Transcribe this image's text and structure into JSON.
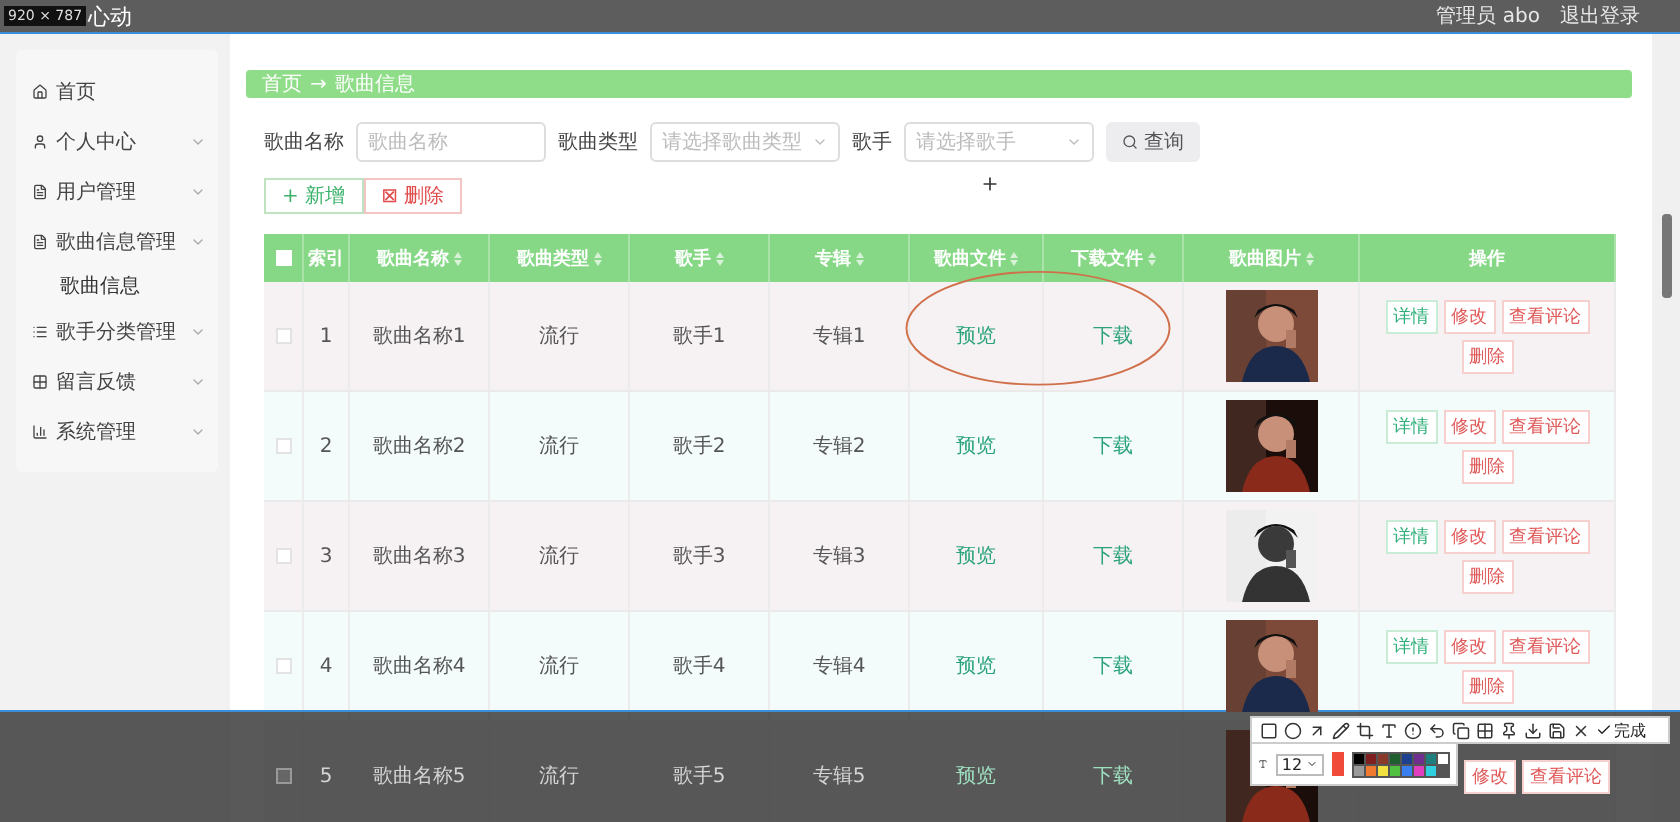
{
  "header": {
    "size_label": "920 × 787",
    "title": "心动",
    "user": "管理员 abo",
    "logout": "退出登录"
  },
  "sidebar": {
    "items": [
      {
        "label": "首页",
        "expandable": false
      },
      {
        "label": "个人中心",
        "expandable": true
      },
      {
        "label": "用户管理",
        "expandable": true
      },
      {
        "label": "歌曲信息管理",
        "expandable": true,
        "children": [
          {
            "label": "歌曲信息"
          }
        ]
      },
      {
        "label": "歌手分类管理",
        "expandable": true
      },
      {
        "label": "留言反馈",
        "expandable": true
      },
      {
        "label": "系统管理",
        "expandable": true
      }
    ]
  },
  "breadcrumb": [
    "首页",
    "→",
    "歌曲信息"
  ],
  "search": {
    "fields": [
      {
        "label": "歌曲名称",
        "placeholder": "歌曲名称",
        "kind": "input"
      },
      {
        "label": "歌曲类型",
        "placeholder": "请选择歌曲类型",
        "kind": "select"
      },
      {
        "label": "歌手",
        "placeholder": "请选择歌手",
        "kind": "select"
      }
    ],
    "button": "查询"
  },
  "actions": [
    {
      "label": "新增",
      "symbol": "+",
      "kind": "add"
    },
    {
      "label": "删除",
      "symbol": "⊠",
      "kind": "delete"
    }
  ],
  "table": {
    "header_checked": false,
    "columns": [
      {
        "label": "索引",
        "sortable": false
      },
      {
        "label": "歌曲名称",
        "sortable": true
      },
      {
        "label": "歌曲类型",
        "sortable": true
      },
      {
        "label": "歌手",
        "sortable": true
      },
      {
        "label": "专辑",
        "sortable": true
      },
      {
        "label": "歌曲文件",
        "sortable": true
      },
      {
        "label": "下载文件",
        "sortable": true
      },
      {
        "label": "歌曲图片",
        "sortable": true
      },
      {
        "label": "操作",
        "sortable": false
      }
    ],
    "rows": [
      {
        "checked": false,
        "dimmed": false,
        "cells": [
          "1",
          "歌曲名称1",
          "流行",
          "歌手1",
          "专辑1"
        ],
        "file": "预览",
        "download": "下载",
        "image": {
          "kind": "picture"
        },
        "buttons": [
          {
            "label": "详情",
            "kind": "info"
          },
          {
            "label": "修改",
            "kind": "danger"
          },
          {
            "label": "查看评论",
            "kind": "danger"
          },
          {
            "label": "删除",
            "kind": "danger"
          }
        ]
      },
      {
        "checked": false,
        "dimmed": false,
        "cells": [
          "2",
          "歌曲名称2",
          "流行",
          "歌手2",
          "专辑2"
        ],
        "file": "预览",
        "download": "下载",
        "image": {
          "kind": "picture"
        },
        "buttons": [
          {
            "label": "详情",
            "kind": "info"
          },
          {
            "label": "修改",
            "kind": "danger"
          },
          {
            "label": "查看评论",
            "kind": "danger"
          },
          {
            "label": "删除",
            "kind": "danger"
          }
        ]
      },
      {
        "checked": false,
        "dimmed": false,
        "cells": [
          "3",
          "歌曲名称3",
          "流行",
          "歌手3",
          "专辑3"
        ],
        "file": "预览",
        "download": "下载",
        "image": {
          "kind": "picture"
        },
        "buttons": [
          {
            "label": "详情",
            "kind": "info"
          },
          {
            "label": "修改",
            "kind": "danger"
          },
          {
            "label": "查看评论",
            "kind": "danger"
          },
          {
            "label": "删除",
            "kind": "danger"
          }
        ]
      },
      {
        "checked": false,
        "dimmed": false,
        "cells": [
          "4",
          "歌曲名称4",
          "流行",
          "歌手4",
          "专辑4"
        ],
        "file": "预览",
        "download": "下载",
        "image": {
          "kind": "picture"
        },
        "buttons": [
          {
            "label": "详情",
            "kind": "info"
          },
          {
            "label": "修改",
            "kind": "danger"
          },
          {
            "label": "查看评论",
            "kind": "danger"
          },
          {
            "label": "删除",
            "kind": "danger"
          }
        ]
      },
      {
        "checked": false,
        "dimmed": true,
        "cells": [
          "5",
          "歌曲名称5",
          "流行",
          "歌手5",
          "专辑5"
        ],
        "file": "预览",
        "download": "下载",
        "image": {
          "kind": "picture"
        },
        "buttons": [
          {
            "label": "修改",
            "kind": "danger"
          },
          {
            "label": "查看评论",
            "kind": "danger"
          }
        ]
      }
    ]
  },
  "capture_toolbar": {
    "size_select": "12",
    "done": "完成",
    "palette": [
      {
        "color": "#f04a3a",
        "selected": true
      },
      {
        "color": "#000000",
        "selected": false
      },
      {
        "color": "#7f1f1f",
        "selected": false
      },
      {
        "color": "#8a3a2a",
        "selected": false
      },
      {
        "color": "#1f5f2f",
        "selected": false
      },
      {
        "color": "#1f3f8f",
        "selected": false
      },
      {
        "color": "#6f2f8f",
        "selected": false
      },
      {
        "color": "#1f7f7f",
        "selected": false
      },
      {
        "color": "#ffffff",
        "selected": false
      },
      {
        "color": "#9a9a9a",
        "selected": false
      },
      {
        "color": "#f07a30",
        "selected": false
      },
      {
        "color": "#f0e040",
        "selected": false
      },
      {
        "color": "#50c040",
        "selected": false
      },
      {
        "color": "#3a7ff0",
        "selected": false
      },
      {
        "color": "#e040c0",
        "selected": false
      },
      {
        "color": "#30d0e0",
        "selected": false
      }
    ]
  }
}
